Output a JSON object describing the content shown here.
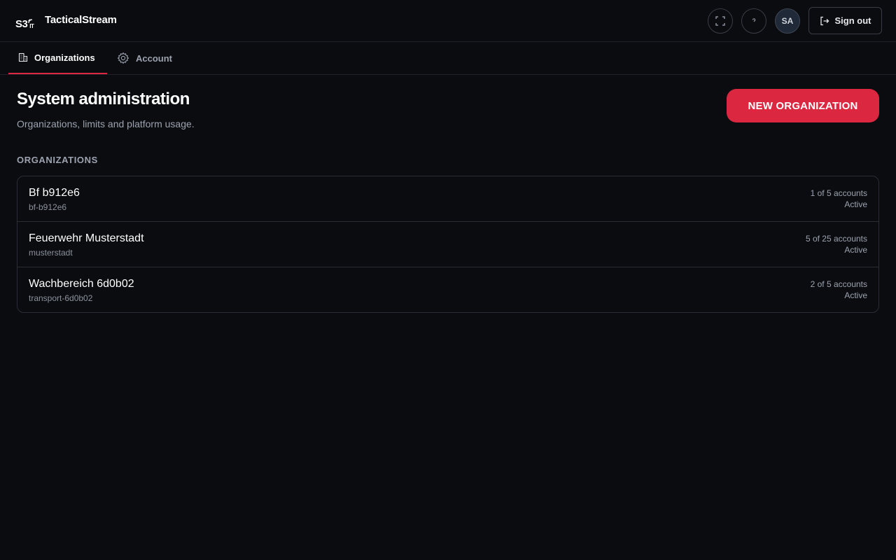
{
  "header": {
    "logo_text": "S3",
    "logo_sub": "IT",
    "app_name": "TacticalStream",
    "avatar_initials": "SA",
    "signout_label": "Sign out"
  },
  "tabs": [
    {
      "label": "Organizations",
      "active": true,
      "icon": "building-icon"
    },
    {
      "label": "Account",
      "active": false,
      "icon": "gear-icon"
    }
  ],
  "main": {
    "title": "System administration",
    "subtitle": "Organizations, limits and platform usage.",
    "new_org_label": "NEW ORGANIZATION",
    "section_label": "ORGANIZATIONS"
  },
  "organizations": [
    {
      "name": "Bf b912e6",
      "slug": "bf-b912e6",
      "accounts": "1 of 5 accounts",
      "status": "Active"
    },
    {
      "name": "Feuerwehr Musterstadt",
      "slug": "musterstadt",
      "accounts": "5 of 25 accounts",
      "status": "Active"
    },
    {
      "name": "Wachbereich 6d0b02",
      "slug": "transport-6d0b02",
      "accounts": "2 of 5 accounts",
      "status": "Active"
    }
  ],
  "colors": {
    "background": "#0b0c10",
    "accent": "#dc2740",
    "border": "#2a2d35"
  }
}
